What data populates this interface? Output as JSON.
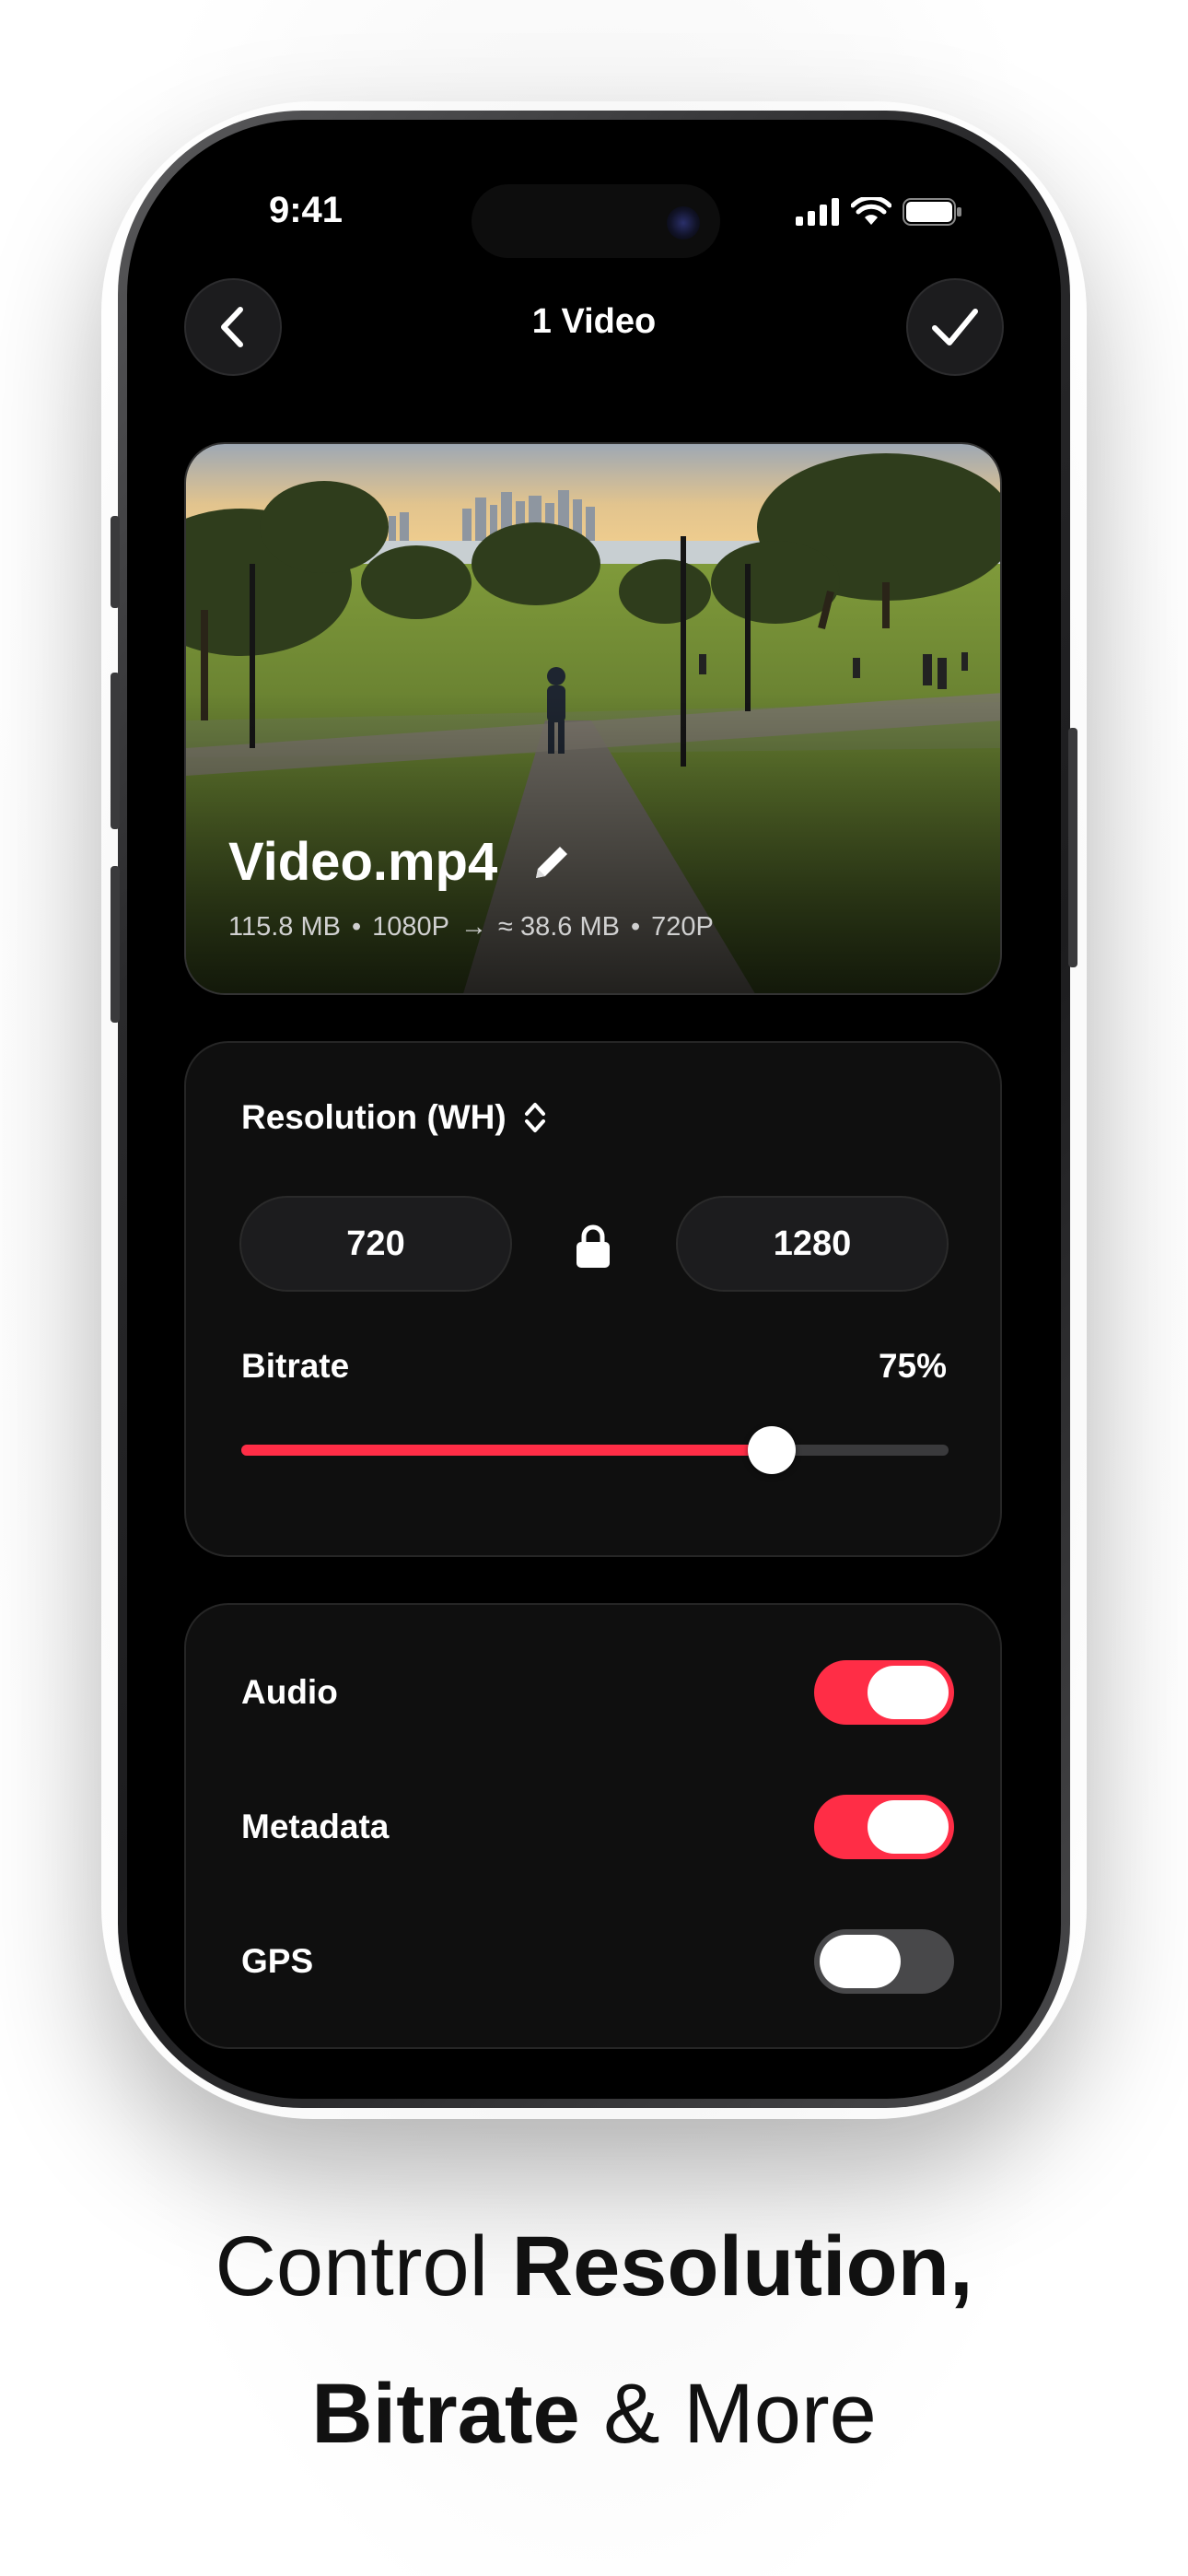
{
  "status_bar": {
    "time": "9:41"
  },
  "header": {
    "title": "1 Video",
    "back_icon": "chevron-left-icon",
    "confirm_icon": "checkmark-icon"
  },
  "video": {
    "name": "Video.mp4",
    "original_size": "115.8 MB",
    "original_resolution": "1080P",
    "arrow": "→",
    "estimated_size": "≈ 38.6 MB",
    "target_resolution": "720P",
    "separator": "•",
    "edit_icon": "pencil-icon"
  },
  "resolution": {
    "label": "Resolution (WH)",
    "width": "720",
    "height": "1280",
    "lock_icon": "lock-icon",
    "sort_icon": "chevron-up-down-icon"
  },
  "bitrate": {
    "label": "Bitrate",
    "value_text": "75%",
    "value": 0.75
  },
  "toggles": [
    {
      "label": "Audio",
      "on": true
    },
    {
      "label": "Metadata",
      "on": true
    },
    {
      "label": "GPS",
      "on": false
    }
  ],
  "caption": {
    "line1_regular": "Control ",
    "line1_bold": "Resolution,",
    "line2_bold": "Bitrate",
    "line2_regular": " & More"
  },
  "colors": {
    "accent": "#ff2d46",
    "card_background": "#0f0f0f",
    "toggle_off": "#48484a"
  }
}
